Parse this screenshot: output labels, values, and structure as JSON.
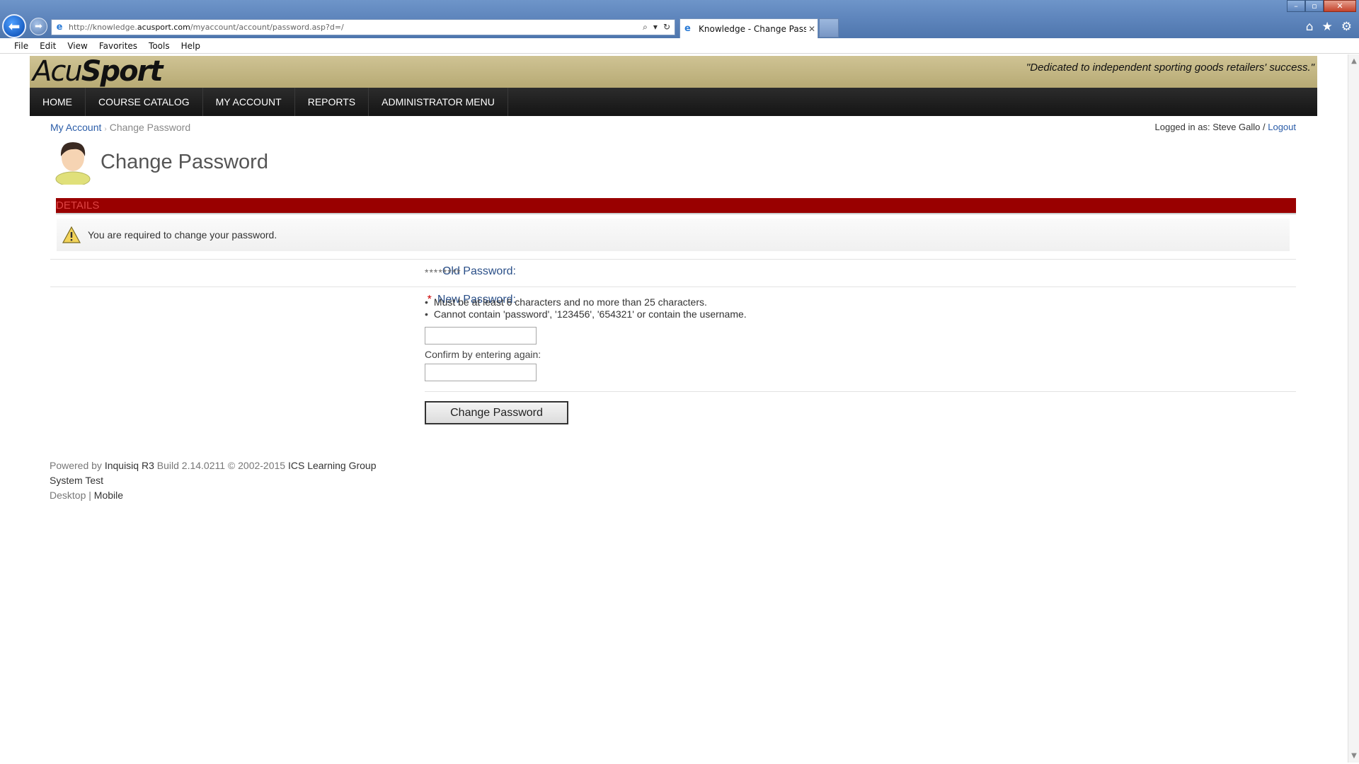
{
  "browser": {
    "address_url_prefix": "http://knowledge.",
    "address_url_domain": "acusport.com",
    "address_url_path": "/myaccount/account/password.asp?d=/",
    "tab_title": "Knowledge - Change Passw...",
    "menu": [
      "File",
      "Edit",
      "View",
      "Favorites",
      "Tools",
      "Help"
    ]
  },
  "header": {
    "logo_part1": "Acu",
    "logo_part2": "Sport",
    "tagline": "\"Dedicated to independent sporting goods retailers' success.\""
  },
  "nav": [
    "HOME",
    "COURSE CATALOG",
    "MY ACCOUNT",
    "REPORTS",
    "ADMINISTRATOR MENU"
  ],
  "breadcrumb": {
    "parent": "My Account",
    "separator": "›",
    "current": "Change Password"
  },
  "login": {
    "prefix": "Logged in as: Steve Gallo / ",
    "logout": "Logout"
  },
  "page": {
    "title": "Change Password",
    "section": "DETAILS",
    "notice": "You are required to change your password."
  },
  "form": {
    "old_label": "Old Password:",
    "old_value": "********",
    "new_required_mark": "*",
    "new_label": "New Password:",
    "rules": [
      "Must be at least 6 characters and no more than 25 characters.",
      "Cannot contain 'password', '123456', '654321' or contain the username."
    ],
    "new_value": "",
    "confirm_label": "Confirm by entering again:",
    "confirm_value": "",
    "submit": "Change Password"
  },
  "footer": {
    "powered_prefix": "Powered by ",
    "product": "Inquisiq R3",
    "build": " Build 2.14.0211  © 2002-2015 ",
    "company": "ICS Learning Group",
    "line2": "System Test",
    "desktop": "Desktop",
    "divider": " | ",
    "mobile": "Mobile"
  },
  "colors": {
    "section_bar": "#990000",
    "nav_bg": "#1a1a1a",
    "banner_bg": "#c4b783",
    "link": "#2a5ca8"
  }
}
